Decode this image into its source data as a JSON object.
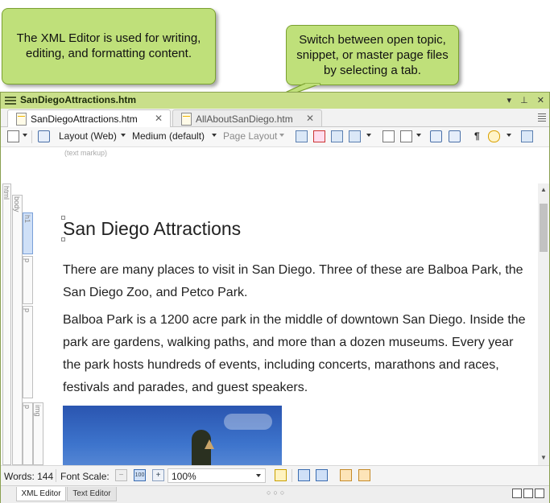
{
  "callouts": {
    "left": "The XML Editor is used for writing, editing, and formatting content.",
    "right": "Switch between open topic, snippet, or master page files by selecting a tab."
  },
  "window": {
    "title": "SanDiegoAttractions.htm",
    "tabs": [
      {
        "label": "SanDiegoAttractions.htm",
        "active": true
      },
      {
        "label": "AllAboutSanDiego.htm",
        "active": false
      }
    ]
  },
  "toolbar": {
    "layout_select": "Layout (Web)",
    "medium_select": "Medium (default)",
    "page_layout_select": "Page Layout"
  },
  "markup_label": "(text markup)",
  "structure": {
    "html": "html",
    "body": "body",
    "h1": "h1",
    "p": "p",
    "img": "img"
  },
  "document": {
    "heading": "San Diego Attractions",
    "paragraphs": [
      "There are many places to visit in San Diego. Three of these are Balboa Park, the San Diego Zoo, and Petco Park.",
      "Balboa Park is a 1200 acre park in the middle of downtown San Diego. Inside the park are gardens, walking paths, and more than a dozen museums. Every year the park hosts hundreds of events, including concerts, marathons and races, festivals and parades, and guest speakers."
    ]
  },
  "statusbar": {
    "words": "Words: 144",
    "font_scale_label": "Font Scale:",
    "zoom": "100%"
  },
  "bottom_tabs": [
    {
      "label": "XML Editor",
      "active": true
    },
    {
      "label": "Text Editor",
      "active": false
    }
  ],
  "colors": {
    "callout_fill": "#bfe07a",
    "titlebar": "#c9df8a"
  }
}
